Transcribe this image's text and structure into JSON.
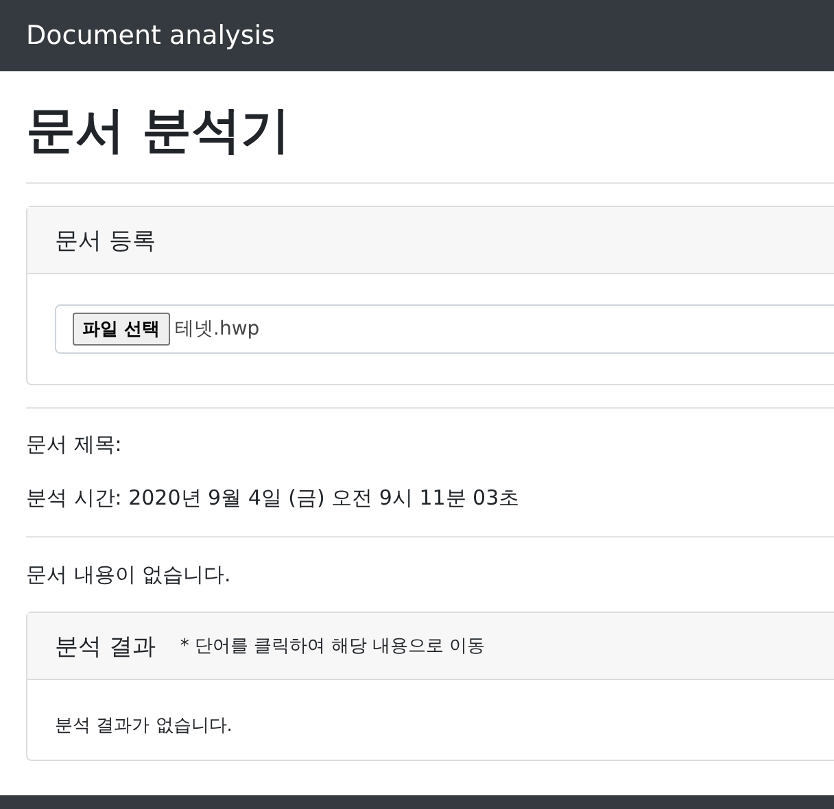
{
  "navbar": {
    "brand": "Document analysis"
  },
  "heading": "문서 분석기",
  "upload_card": {
    "title": "문서 등록",
    "file_input": {
      "button": "파일 선택",
      "file_name": "테넷.hwp"
    }
  },
  "info": {
    "doc_title": "문서 제목:",
    "analysis_time": "분석 시간: 2020년 9월 4일 (금) 오전 9시 11분 03초"
  },
  "content_message": "문서 내용이 없습니다.",
  "result_card": {
    "title": "분석 결과",
    "hint": "* 단어를 클릭하여 해당 내용으로 이동",
    "message": "분석 결과가 없습니다."
  }
}
